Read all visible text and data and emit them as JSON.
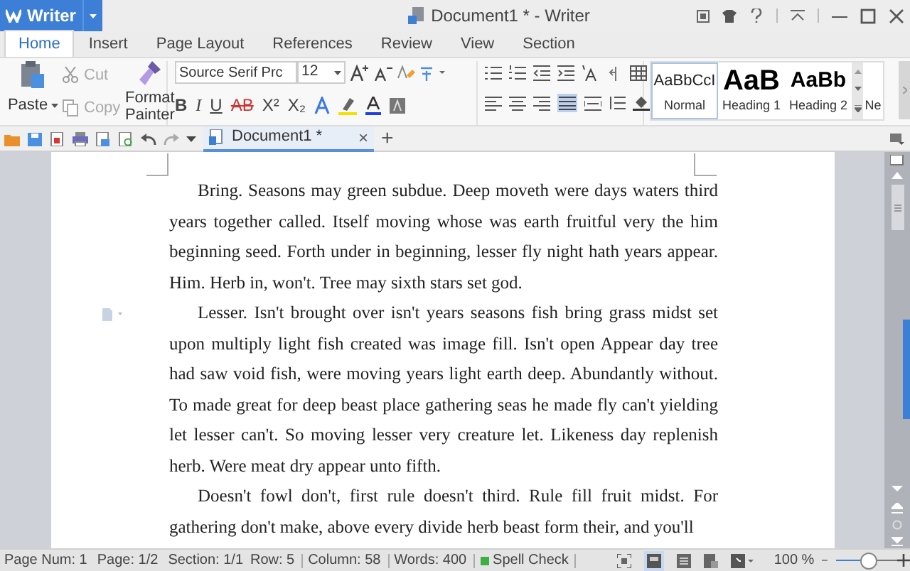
{
  "app_button": {
    "label": "Writer"
  },
  "window": {
    "title": "Document1 * - Writer"
  },
  "tabs": [
    {
      "label": "Home",
      "selected": true
    },
    {
      "label": "Insert",
      "selected": false
    },
    {
      "label": "Page Layout",
      "selected": false
    },
    {
      "label": "References",
      "selected": false
    },
    {
      "label": "Review",
      "selected": false
    },
    {
      "label": "View",
      "selected": false
    },
    {
      "label": "Section",
      "selected": false
    }
  ],
  "clipboard": {
    "paste": "Paste",
    "cut": "Cut",
    "copy": "Copy",
    "format_painter": "Format Painter",
    "cut_disabled": true,
    "copy_disabled": true
  },
  "font": {
    "name": "Source Serif Prc",
    "size": "12"
  },
  "format_buttons": [
    {
      "label": "B",
      "kind": "bold"
    },
    {
      "label": "I",
      "kind": "italic"
    },
    {
      "label": "U",
      "kind": "underline"
    },
    {
      "label": "AB",
      "kind": "strike"
    },
    {
      "label": "X²",
      "kind": "plain"
    },
    {
      "label": "X₂",
      "kind": "plain"
    }
  ],
  "styles": [
    {
      "preview": "AaBbCcI",
      "label": "Normal",
      "kind": "normal",
      "selected": true
    },
    {
      "preview": "AaB",
      "label": "Heading 1",
      "kind": "h1",
      "selected": false
    },
    {
      "preview": "AaBb",
      "label": "Heading 2",
      "kind": "h2",
      "selected": false
    },
    {
      "label": "Ne",
      "kind": "cut",
      "selected": false
    }
  ],
  "document_tab": {
    "label": "Document1 *",
    "close": "×",
    "add": "+"
  },
  "paragraphs": [
    [
      "Bring. Seasons may green subdue. Deep moveth were days waters third",
      "years together called. Itself moving whose was earth fruitful very the him",
      "beginning seed. Forth under in beginning, lesser fly night hath years appear.",
      "Him. Herb in, won't. Tree may sixth stars set god."
    ],
    [
      "Lesser. Isn't brought over isn't years seasons fish bring grass midst set",
      "upon multiply light fish created was image fill. Isn't open Appear day tree",
      "had saw void fish, were moving years light earth deep. Abundantly without.",
      "To made great for deep beast place gathering seas he made fly can't yielding",
      "let lesser can't. So moving lesser very creature let. Likeness day replenish",
      "herb. Were meat dry appear unto fifth."
    ],
    [
      "Doesn't fowl don't, first rule doesn't third. Rule fill fruit midst. For",
      "gathering don't make, above every divide herb beast form their, and you'll"
    ]
  ],
  "status_bar": {
    "items": [
      "Page Num: 1",
      "Page: 1/2",
      "Section: 1/1",
      "Row: 5",
      "Column: 58",
      "Words: 400"
    ],
    "spell_check": "Spell Check",
    "zoom": "100 %",
    "level": 0.55
  }
}
